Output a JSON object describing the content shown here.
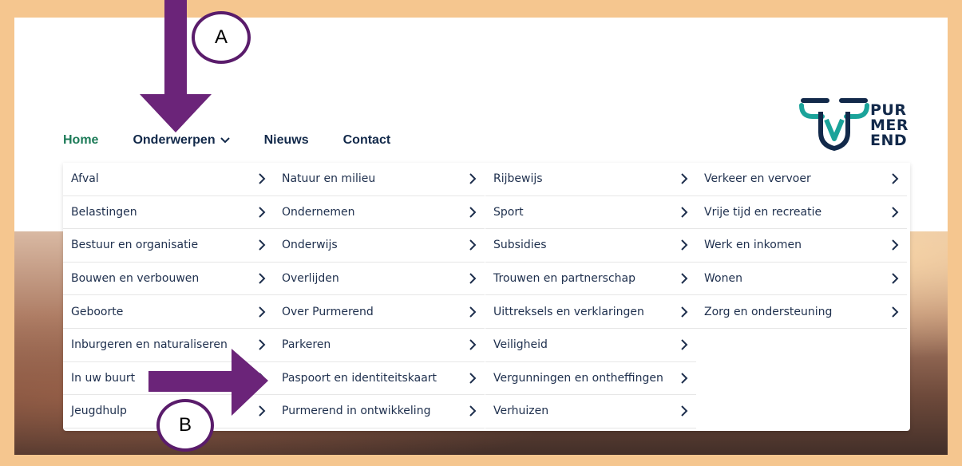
{
  "logo": {
    "lines": [
      "PUR",
      "MER",
      "END"
    ],
    "icon": "purmerend-cow-logo-icon"
  },
  "nav": {
    "home": "Home",
    "onderwerpen": "Onderwerpen",
    "nieuws": "Nieuws",
    "contact": "Contact"
  },
  "menu": {
    "columns": [
      [
        "Afval",
        "Belastingen",
        "Bestuur en organisatie",
        "Bouwen en verbouwen",
        "Geboorte",
        "Inburgeren en naturaliseren",
        "In uw buurt",
        "Jeugdhulp"
      ],
      [
        "Natuur en milieu",
        "Ondernemen",
        "Onderwijs",
        "Overlijden",
        "Over Purmerend",
        "Parkeren",
        "Paspoort en identiteitskaart",
        "Purmerend in ontwikkeling"
      ],
      [
        "Rijbewijs",
        "Sport",
        "Subsidies",
        "Trouwen en partnerschap",
        "Uittreksels en verklaringen",
        "Veiligheid",
        "Vergunningen en ontheffingen",
        "Verhuizen"
      ],
      [
        "Verkeer en vervoer",
        "Vrije tijd en recreatie",
        "Werk en inkomen",
        "Wonen",
        "Zorg en ondersteuning"
      ]
    ]
  },
  "annotations": {
    "a": "A",
    "b": "B",
    "arrow_color": "#6b2479",
    "frame_color": "#f5c68f"
  },
  "colors": {
    "nav_active": "#1d7b58",
    "nav_text": "#12294a",
    "logo_teal": "#1aa39a",
    "logo_navy": "#12294a"
  }
}
